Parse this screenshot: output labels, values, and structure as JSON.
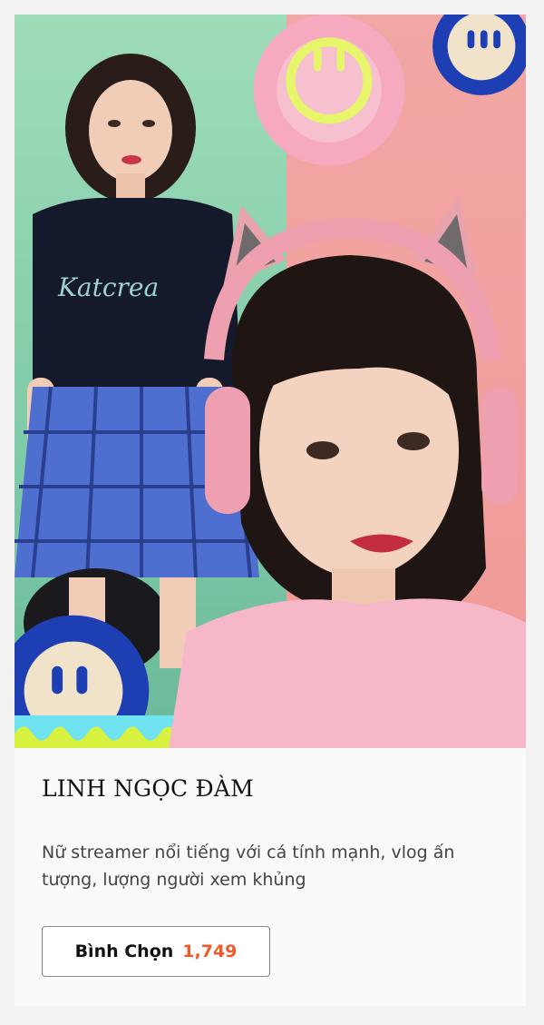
{
  "card": {
    "name": "LINH NGỌC ĐÀM",
    "description": "Nữ streamer nổi tiếng với cá tính mạnh, vlog ấn tượng, lượng người xem khủng",
    "vote_label": "Bình Chọn",
    "vote_count": "1,749",
    "photo_icon": "portrait-collage-image"
  },
  "colors": {
    "vote_count": "#ef5a2a",
    "card_bg": "#fafafa",
    "page_bg": "#f2f2f2"
  }
}
